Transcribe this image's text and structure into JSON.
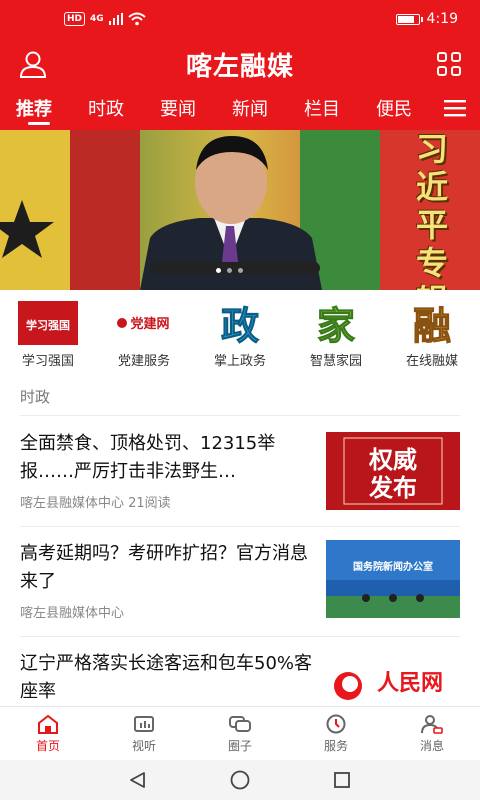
{
  "status_bar": {
    "hd": "HD",
    "network": "4G",
    "time": "4:19",
    "battery_level": 0.85
  },
  "header": {
    "title": "喀左融媒"
  },
  "tabs": [
    {
      "label": "推荐",
      "active": true
    },
    {
      "label": "时政",
      "active": false
    },
    {
      "label": "要闻",
      "active": false
    },
    {
      "label": "新闻",
      "active": false
    },
    {
      "label": "栏目",
      "active": false
    },
    {
      "label": "便民",
      "active": false
    }
  ],
  "banner": {
    "text": "习近平专辑",
    "slides": 3,
    "current": 1
  },
  "shortcuts": [
    {
      "label": "学习强国",
      "logo_text": "学习强国"
    },
    {
      "label": "党建服务",
      "logo_text": "党建网"
    },
    {
      "label": "掌上政务",
      "logo_text": "政"
    },
    {
      "label": "智慧家园",
      "logo_text": "家"
    },
    {
      "label": "在线融媒",
      "logo_text": "融"
    }
  ],
  "section": {
    "label": "时政"
  },
  "news": [
    {
      "title": "全面禁食、顶格处罚、12315举报……严厉打击非法野生…",
      "meta": "喀左县融媒体中心 21阅读",
      "thumb_text": "权威发布"
    },
    {
      "title": "高考延期吗？考研咋扩招？官方消息来了",
      "meta": "喀左县融媒体中心",
      "thumb_text": "国务院新闻办公室"
    },
    {
      "title": "辽宁严格落实长途客运和包车50%客座率",
      "meta": "",
      "thumb_text": "人民网 people.cn"
    }
  ],
  "bottom_nav": [
    {
      "label": "首页",
      "icon": "home-icon",
      "active": true
    },
    {
      "label": "视听",
      "icon": "tv-icon",
      "active": false
    },
    {
      "label": "圈子",
      "icon": "chat-icon",
      "active": false
    },
    {
      "label": "服务",
      "icon": "clock-service-icon",
      "active": false
    },
    {
      "label": "消息",
      "icon": "user-message-icon",
      "active": false
    }
  ],
  "colors": {
    "brand_red": "#e8171c",
    "accent_gold": "#f6e27a"
  }
}
